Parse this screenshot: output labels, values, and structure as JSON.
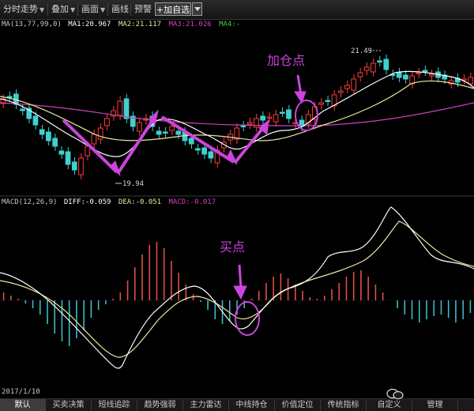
{
  "toolbar": {
    "items": [
      {
        "label": "分时走势",
        "arrow": true
      },
      {
        "label": "叠加",
        "arrow": true
      },
      {
        "label": "画面",
        "arrow": true
      },
      {
        "label": "画线",
        "arrow": false
      },
      {
        "label": "预警",
        "arrow": false
      }
    ],
    "add_label": "+加自选"
  },
  "price_legend": {
    "ma_label": "MA(13,77,99,0)",
    "ma1": "MA1:20.967",
    "ma2": "MA2:21.117",
    "ma3": "MA3:21.026",
    "ma4": "MA4:-"
  },
  "macd_legend": {
    "label": "MACD(12,26,9)",
    "diff": "DIFF:-0.059",
    "dea": "DEA:-0.051",
    "macd": "MACD:-0.017"
  },
  "annotations": {
    "high_price": "21.49",
    "low_price": "19.94",
    "add_position": "加仓点",
    "buy_point": "买点"
  },
  "date": "2017/1/10",
  "tabs": [
    {
      "label": "默认",
      "active": true
    },
    {
      "label": "买卖决策",
      "active": false
    },
    {
      "label": "短线追踪",
      "active": false
    },
    {
      "label": "趋势强弱",
      "active": false
    },
    {
      "label": "主力雷达",
      "active": false
    },
    {
      "label": "中线持仓",
      "active": false
    },
    {
      "label": "价值定位",
      "active": false
    },
    {
      "label": "传统指标",
      "active": false
    },
    {
      "label": "自定义",
      "active": false
    },
    {
      "label": "管理",
      "active": false
    }
  ],
  "watermark": "（微信图标）",
  "colors": {
    "up": "#ff3c3c",
    "down": "#3fd0d0",
    "ma1": "#ffffff",
    "ma2": "#e8e8a0",
    "ma3": "#d040c0",
    "annotation": "#cc44dd",
    "macd_up": "#e05040",
    "macd_down": "#40b8c8"
  }
}
